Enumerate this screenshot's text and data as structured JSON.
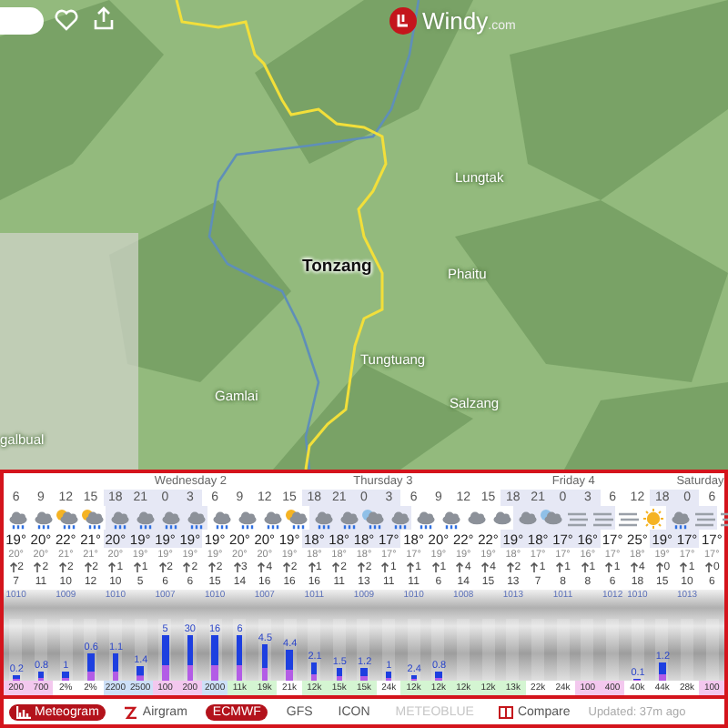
{
  "map": {
    "logo": {
      "name": "Windy",
      "suffix": ".com"
    },
    "places": [
      {
        "label": "Lungtak",
        "kind": "village"
      },
      {
        "label": "Tonzang",
        "kind": "town"
      },
      {
        "label": "Phaitu",
        "kind": "village"
      },
      {
        "label": "Tungtuang",
        "kind": "village"
      },
      {
        "label": "Salzang",
        "kind": "village"
      },
      {
        "label": "Gamlai",
        "kind": "village"
      },
      {
        "label": "galbual",
        "kind": "village"
      }
    ]
  },
  "forecast": {
    "days": [
      {
        "columns": [
          {
            "hour": "6",
            "kind": "rain",
            "temp": "19°",
            "feels": "20°",
            "wind": "2",
            "gust": "7",
            "night": false,
            "pressure": "1010",
            "precip": "0.2",
            "level": 0.1,
            "base": "200",
            "color": "#f3c8ee"
          },
          {
            "hour": "9",
            "kind": "rain",
            "temp": "20°",
            "feels": "20°",
            "wind": "2",
            "gust": "11",
            "night": false,
            "precip": "0.8",
            "level": 0.15,
            "base": "700",
            "color": "#f3c8ee"
          },
          {
            "hour": "12",
            "kind": "sun-rain",
            "temp": "22°",
            "feels": "21°",
            "wind": "2",
            "gust": "10",
            "night": false,
            "pressure": "1009",
            "precip": "1",
            "level": 0.15,
            "base": "2%",
            "color": "#ffffff"
          },
          {
            "hour": "15",
            "kind": "sun-rain",
            "temp": "21°",
            "feels": "21°",
            "wind": "2",
            "gust": "12",
            "night": false,
            "precip": "0.6",
            "level": 0.45,
            "base": "2%",
            "color": "#ffffff"
          },
          {
            "hour": "18",
            "kind": "rain",
            "temp": "20°",
            "feels": "20°",
            "wind": "1",
            "gust": "10",
            "night": true,
            "pressure": "1010",
            "precip": "1.1",
            "level": 0.45,
            "base": "2200",
            "color": "#cde0f7"
          },
          {
            "hour": "21",
            "kind": "rain",
            "temp": "19°",
            "feels": "19°",
            "wind": "1",
            "gust": "5",
            "night": true,
            "precip": "1.4",
            "level": 0.25,
            "base": "2500",
            "color": "#cde0f7"
          }
        ]
      },
      {
        "label": "Wednesday 2",
        "columns": [
          {
            "hour": "0",
            "kind": "rain",
            "temp": "19°",
            "feels": "19°",
            "wind": "2",
            "gust": "6",
            "night": true,
            "pressure": "1007",
            "precip": "5",
            "level": 0.75,
            "base": "100",
            "color": "#f3c8ee"
          },
          {
            "hour": "3",
            "kind": "rain",
            "temp": "19°",
            "feels": "19°",
            "wind": "2",
            "gust": "6",
            "night": true,
            "precip": "30",
            "level": 0.75,
            "base": "200",
            "color": "#f3c8ee"
          },
          {
            "hour": "6",
            "kind": "rain",
            "temp": "19°",
            "feels": "19°",
            "wind": "2",
            "gust": "15",
            "night": false,
            "pressure": "1010",
            "precip": "16",
            "level": 0.75,
            "base": "2000",
            "color": "#cde0f7"
          },
          {
            "hour": "9",
            "kind": "rain",
            "temp": "20°",
            "feels": "20°",
            "wind": "3",
            "gust": "14",
            "night": false,
            "precip": "6",
            "level": 0.75,
            "base": "11k",
            "color": "#d4f5d2"
          },
          {
            "hour": "12",
            "kind": "rain",
            "temp": "20°",
            "feels": "20°",
            "wind": "4",
            "gust": "16",
            "night": false,
            "pressure": "1007",
            "precip": "4.5",
            "level": 0.6,
            "base": "19k",
            "color": "#d4f5d2"
          },
          {
            "hour": "15",
            "kind": "sun-rain",
            "temp": "19°",
            "feels": "19°",
            "wind": "2",
            "gust": "16",
            "night": false,
            "precip": "4.4",
            "level": 0.5,
            "base": "21k",
            "color": "#ffffff"
          },
          {
            "hour": "18",
            "kind": "rain",
            "temp": "18°",
            "feels": "18°",
            "wind": "1",
            "gust": "16",
            "night": true,
            "pressure": "1011",
            "precip": "2.1",
            "level": 0.3,
            "base": "12k",
            "color": "#d4f5d2"
          },
          {
            "hour": "21",
            "kind": "rain",
            "temp": "18°",
            "feels": "18°",
            "wind": "2",
            "gust": "11",
            "night": true,
            "precip": "1.5",
            "level": 0.2,
            "base": "15k",
            "color": "#d4f5d2"
          }
        ]
      },
      {
        "label": "Thursday 3",
        "columns": [
          {
            "hour": "0",
            "kind": "moon-rain",
            "temp": "18°",
            "feels": "18°",
            "wind": "2",
            "gust": "13",
            "night": true,
            "pressure": "1009",
            "precip": "1.2",
            "level": 0.2,
            "base": "15k",
            "color": "#d4f5d2"
          },
          {
            "hour": "3",
            "kind": "rain",
            "temp": "17°",
            "feels": "17°",
            "wind": "1",
            "gust": "11",
            "night": true,
            "precip": "1",
            "level": 0.15,
            "base": "24k",
            "color": "#ffffff"
          },
          {
            "hour": "6",
            "kind": "rain",
            "temp": "18°",
            "feels": "17°",
            "wind": "1",
            "gust": "11",
            "night": false,
            "pressure": "1010",
            "precip": "2.4",
            "level": 0.1,
            "base": "12k",
            "color": "#d4f5d2"
          },
          {
            "hour": "9",
            "kind": "rain",
            "temp": "20°",
            "feels": "19°",
            "wind": "1",
            "gust": "6",
            "night": false,
            "precip": "0.8",
            "level": 0.15,
            "base": "12k",
            "color": "#d4f5d2"
          },
          {
            "hour": "12",
            "kind": "cloud",
            "temp": "22°",
            "feels": "19°",
            "wind": "4",
            "gust": "14",
            "night": false,
            "pressure": "1008",
            "base": "12k",
            "color": "#d4f5d2"
          },
          {
            "hour": "15",
            "kind": "cloud",
            "temp": "22°",
            "feels": "19°",
            "wind": "4",
            "gust": "15",
            "night": false,
            "base": "12k",
            "color": "#d4f5d2"
          },
          {
            "hour": "18",
            "kind": "cloud",
            "temp": "19°",
            "feels": "18°",
            "wind": "2",
            "gust": "13",
            "night": true,
            "pressure": "1013",
            "base": "13k",
            "color": "#d4f5d2"
          },
          {
            "hour": "21",
            "kind": "moon-cloud",
            "temp": "18°",
            "feels": "17°",
            "wind": "1",
            "gust": "7",
            "night": true,
            "base": "22k",
            "color": "#ffffff"
          }
        ]
      },
      {
        "label": "Friday 4",
        "columns": [
          {
            "hour": "0",
            "kind": "fog",
            "temp": "17°",
            "feels": "17°",
            "wind": "1",
            "gust": "8",
            "night": true,
            "pressure": "1011",
            "base": "24k",
            "color": "#ffffff"
          },
          {
            "hour": "3",
            "kind": "fog",
            "temp": "16°",
            "feels": "16°",
            "wind": "1",
            "gust": "8",
            "night": true,
            "base": "100",
            "color": "#f3c8ee"
          },
          {
            "hour": "6",
            "kind": "fog",
            "temp": "17°",
            "feels": "17°",
            "wind": "1",
            "gust": "6",
            "night": false,
            "pressure": "1012",
            "base": "400",
            "color": "#f3c8ee"
          },
          {
            "hour": "12",
            "kind": "sun",
            "temp": "25°",
            "feels": "18°",
            "wind": "4",
            "gust": "18",
            "night": false,
            "pressure": "1010",
            "precip": "0.1",
            "level": 0.03,
            "base": "40k",
            "color": "#ffffff"
          },
          {
            "hour": "18",
            "kind": "rain",
            "temp": "19°",
            "feels": "19°",
            "wind": "0",
            "gust": "15",
            "night": true,
            "precip": "1.2",
            "level": 0.3,
            "base": "44k",
            "color": "#ffffff"
          }
        ]
      },
      {
        "label": "Saturday",
        "columns": [
          {
            "hour": "0",
            "kind": "fog",
            "temp": "17°",
            "feels": "17°",
            "wind": "1",
            "gust": "10",
            "night": true,
            "pressure": "1013",
            "base": "28k",
            "color": "#ffffff"
          },
          {
            "hour": "6",
            "kind": "fog",
            "temp": "17°",
            "feels": "17°",
            "wind": "0",
            "gust": "6",
            "night": false,
            "base": "100",
            "color": "#f3c8ee"
          }
        ]
      }
    ]
  },
  "toolbar": {
    "views": [
      {
        "label": "Meteogram",
        "kind": "meteogram",
        "selected": true
      },
      {
        "label": "Airgram",
        "kind": "airgram",
        "selected": false
      }
    ],
    "models": [
      {
        "label": "ECMWF",
        "selected": true,
        "disabled": false
      },
      {
        "label": "GFS",
        "selected": false,
        "disabled": false
      },
      {
        "label": "ICON",
        "selected": false,
        "disabled": false
      },
      {
        "label": "METEOBLUE",
        "selected": false,
        "disabled": true
      }
    ],
    "compare": "Compare",
    "updated": "Updated: 37m ago"
  }
}
